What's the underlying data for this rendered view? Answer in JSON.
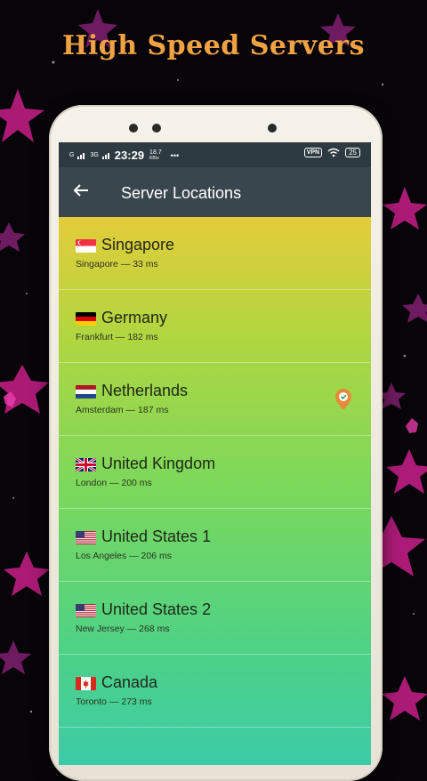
{
  "promo": {
    "headline": "High Speed Servers"
  },
  "status_bar": {
    "signal_left": "G",
    "signal_mid": "3G",
    "time": "23:29",
    "speed_value": "18.7",
    "speed_unit": "KB/s",
    "more": "•••",
    "vpn": "VPN",
    "battery": "25"
  },
  "app_bar": {
    "back_icon": "arrow-left-icon",
    "title": "Server Locations"
  },
  "servers": [
    {
      "country": "Singapore",
      "city": "Singapore",
      "ping": "33 ms",
      "subtitle": "Singapore — 33 ms",
      "flag": "sg"
    },
    {
      "country": "Germany",
      "city": "Frankfurt",
      "ping": "182 ms",
      "subtitle": "Frankfurt — 182 ms",
      "flag": "de"
    },
    {
      "country": "Netherlands",
      "city": "Amsterdam",
      "ping": "187 ms",
      "subtitle": "Amsterdam — 187 ms",
      "flag": "nl",
      "connected": true
    },
    {
      "country": "United Kingdom",
      "city": "London",
      "ping": "200 ms",
      "subtitle": "London — 200 ms",
      "flag": "gb"
    },
    {
      "country": "United States 1",
      "city": "Los Angeles",
      "ping": "206 ms",
      "subtitle": "Los Angeles — 206 ms",
      "flag": "us"
    },
    {
      "country": "United States 2",
      "city": "New Jersey",
      "ping": "268 ms",
      "subtitle": "New Jersey — 268 ms",
      "flag": "us"
    },
    {
      "country": "Canada",
      "city": "Toronto",
      "ping": "273 ms",
      "subtitle": "Toronto — 273 ms",
      "flag": "ca"
    }
  ],
  "colors": {
    "promo_title": "#f0a243",
    "app_bar": "#3a464d",
    "status_bar": "#2e3a41",
    "connected_pin": "#e58a3a"
  }
}
